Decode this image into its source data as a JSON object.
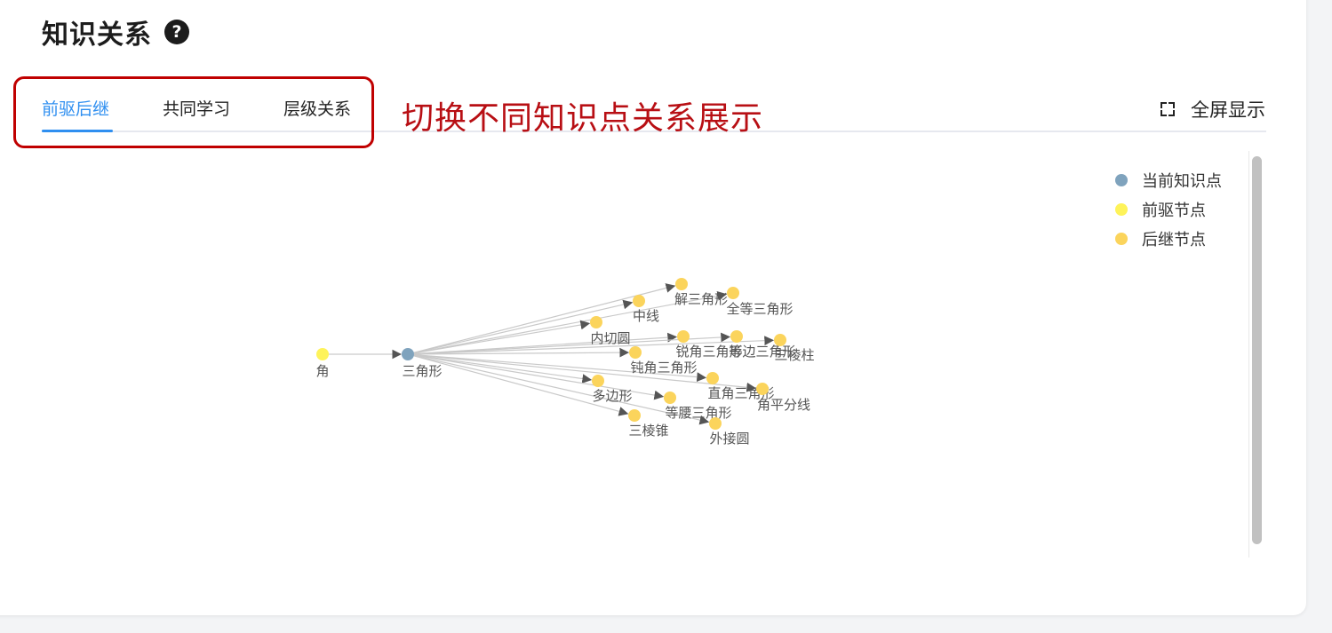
{
  "header": {
    "title": "知识关系",
    "help_icon": "question-circle-icon"
  },
  "tabs": [
    {
      "label": "前驱后继",
      "active": true
    },
    {
      "label": "共同学习",
      "active": false
    },
    {
      "label": "层级关系",
      "active": false
    }
  ],
  "annotation": {
    "text": "切换不同知识点关系展示",
    "color": "#c00000"
  },
  "fullscreen": {
    "label": "全屏显示",
    "icon": "fullscreen-icon"
  },
  "legend": [
    {
      "label": "当前知识点",
      "color": "#7fa3bd"
    },
    {
      "label": "前驱节点",
      "color": "#fef35a"
    },
    {
      "label": "后继节点",
      "color": "#fbd45c"
    }
  ],
  "graph": {
    "nodes": [
      {
        "id": "jiao",
        "label": "角",
        "type": "predecessor"
      },
      {
        "id": "sanjiaoxing",
        "label": "三角形",
        "type": "current"
      },
      {
        "id": "jiesanjiaoxing",
        "label": "解三角形",
        "type": "successor"
      },
      {
        "id": "quandeng",
        "label": "全等三角形",
        "type": "successor"
      },
      {
        "id": "zhongxian",
        "label": "中线",
        "type": "successor"
      },
      {
        "id": "neiqieyuan",
        "label": "内切圆",
        "type": "successor"
      },
      {
        "id": "ruijiao",
        "label": "锐角三角形",
        "type": "successor"
      },
      {
        "id": "dengbian",
        "label": "等边三角形",
        "type": "successor"
      },
      {
        "id": "sanlengzhu",
        "label": "三棱柱",
        "type": "successor"
      },
      {
        "id": "dunjiao",
        "label": "钝角三角形",
        "type": "successor"
      },
      {
        "id": "duobianxing",
        "label": "多边形",
        "type": "successor"
      },
      {
        "id": "zhijiao",
        "label": "直角三角形",
        "type": "successor"
      },
      {
        "id": "jiaopingfenxian",
        "label": "角平分线",
        "type": "successor"
      },
      {
        "id": "dengyao",
        "label": "等腰三角形",
        "type": "successor"
      },
      {
        "id": "sanlengzhui",
        "label": "三棱锥",
        "type": "successor"
      },
      {
        "id": "waijieyuan",
        "label": "外接圆",
        "type": "successor"
      }
    ],
    "edges": [
      [
        "jiao",
        "sanjiaoxing"
      ],
      [
        "sanjiaoxing",
        "jiesanjiaoxing"
      ],
      [
        "sanjiaoxing",
        "quandeng"
      ],
      [
        "sanjiaoxing",
        "zhongxian"
      ],
      [
        "sanjiaoxing",
        "neiqieyuan"
      ],
      [
        "sanjiaoxing",
        "ruijiao"
      ],
      [
        "sanjiaoxing",
        "dengbian"
      ],
      [
        "sanjiaoxing",
        "sanlengzhu"
      ],
      [
        "sanjiaoxing",
        "dunjiao"
      ],
      [
        "sanjiaoxing",
        "duobianxing"
      ],
      [
        "sanjiaoxing",
        "zhijiao"
      ],
      [
        "sanjiaoxing",
        "jiaopingfenxian"
      ],
      [
        "sanjiaoxing",
        "dengyao"
      ],
      [
        "sanjiaoxing",
        "sanlengzhui"
      ],
      [
        "sanjiaoxing",
        "waijieyuan"
      ]
    ]
  }
}
